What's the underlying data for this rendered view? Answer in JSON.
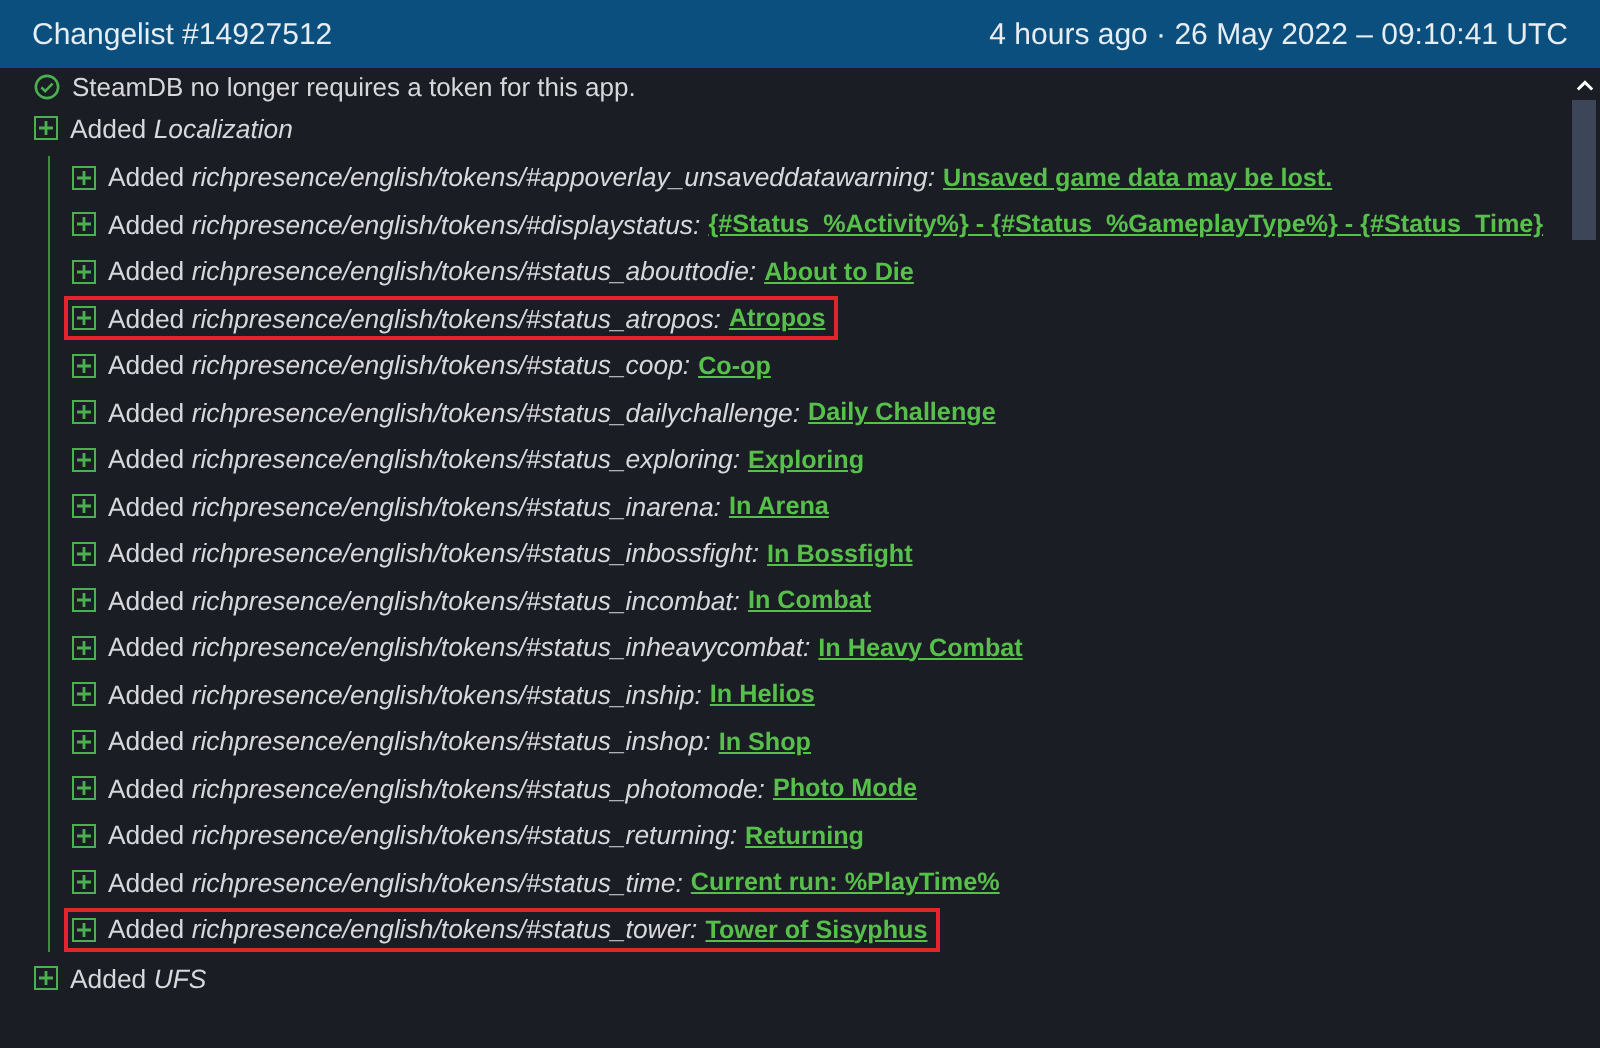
{
  "header": {
    "title": "Changelist #14927512",
    "timestamp": "4 hours ago · 26 May 2022 – 09:10:41 UTC"
  },
  "note": "SteamDB no longer requires a token for this app.",
  "sections": [
    {
      "action": "Added",
      "name": "Localization",
      "children": [
        {
          "action": "Added",
          "path": "richpresence/english/tokens/#appoverlay_unsaveddatawarning:",
          "value": "Unsaved game data may be lost.",
          "highlighted": false
        },
        {
          "action": "Added",
          "path": "richpresence/english/tokens/#displaystatus:",
          "value": "{#Status_%Activity%} - {#Status_%GameplayType%} - {#Status_Time}",
          "highlighted": false
        },
        {
          "action": "Added",
          "path": "richpresence/english/tokens/#status_abouttodie:",
          "value": "About to Die",
          "highlighted": false
        },
        {
          "action": "Added",
          "path": "richpresence/english/tokens/#status_atropos:",
          "value": "Atropos",
          "highlighted": true
        },
        {
          "action": "Added",
          "path": "richpresence/english/tokens/#status_coop:",
          "value": "Co-op",
          "highlighted": false
        },
        {
          "action": "Added",
          "path": "richpresence/english/tokens/#status_dailychallenge:",
          "value": "Daily Challenge",
          "highlighted": false
        },
        {
          "action": "Added",
          "path": "richpresence/english/tokens/#status_exploring:",
          "value": "Exploring",
          "highlighted": false
        },
        {
          "action": "Added",
          "path": "richpresence/english/tokens/#status_inarena:",
          "value": "In Arena",
          "highlighted": false
        },
        {
          "action": "Added",
          "path": "richpresence/english/tokens/#status_inbossfight:",
          "value": "In Bossfight",
          "highlighted": false
        },
        {
          "action": "Added",
          "path": "richpresence/english/tokens/#status_incombat:",
          "value": "In Combat",
          "highlighted": false
        },
        {
          "action": "Added",
          "path": "richpresence/english/tokens/#status_inheavycombat:",
          "value": "In Heavy Combat",
          "highlighted": false
        },
        {
          "action": "Added",
          "path": "richpresence/english/tokens/#status_inship:",
          "value": "In Helios",
          "highlighted": false
        },
        {
          "action": "Added",
          "path": "richpresence/english/tokens/#status_inshop:",
          "value": "In Shop",
          "highlighted": false
        },
        {
          "action": "Added",
          "path": "richpresence/english/tokens/#status_photomode:",
          "value": "Photo Mode",
          "highlighted": false
        },
        {
          "action": "Added",
          "path": "richpresence/english/tokens/#status_returning:",
          "value": "Returning",
          "highlighted": false
        },
        {
          "action": "Added",
          "path": "richpresence/english/tokens/#status_time:",
          "value": "Current run: %PlayTime%",
          "highlighted": false
        },
        {
          "action": "Added",
          "path": "richpresence/english/tokens/#status_tower:",
          "value": "Tower of Sisyphus",
          "highlighted": true
        }
      ]
    },
    {
      "action": "Added",
      "name": "UFS"
    }
  ]
}
